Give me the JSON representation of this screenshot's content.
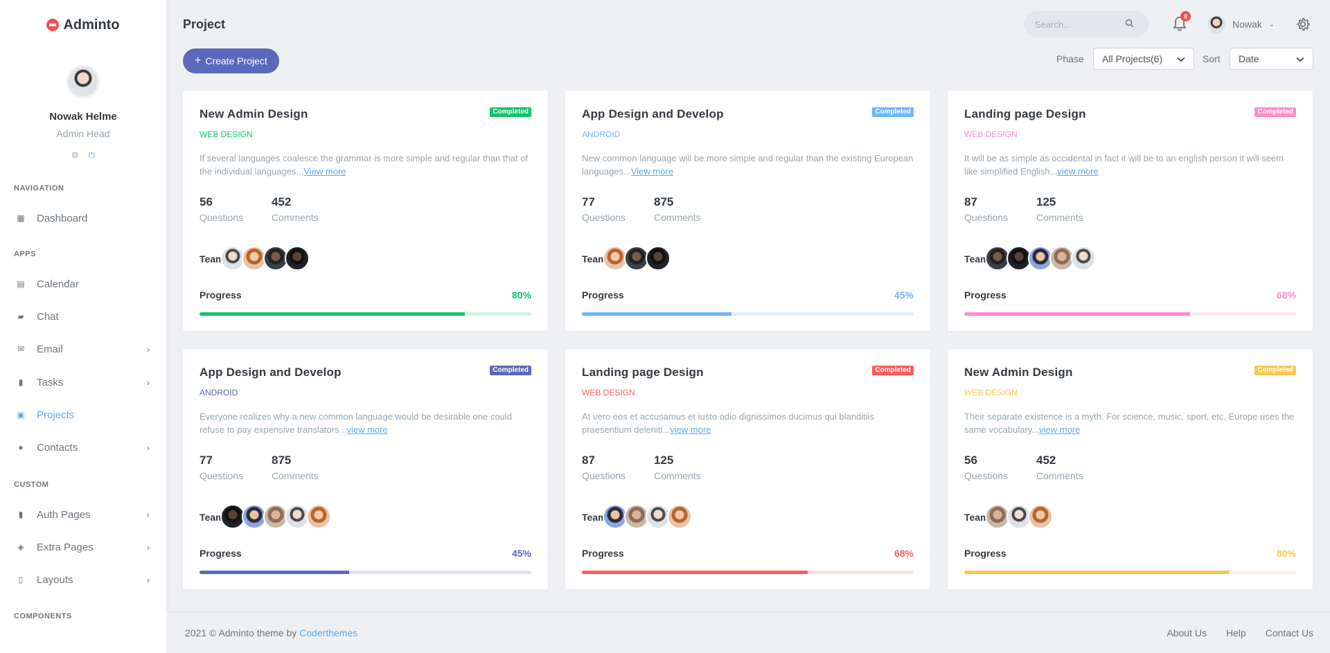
{
  "app": {
    "logo": "Adminto"
  },
  "sidebar": {
    "user_name": "Nowak Helme",
    "user_role": "Admin Head",
    "sections": {
      "navigation": "NAVIGATION",
      "apps": "APPS",
      "custom": "CUSTOM",
      "components": "COMPONENTS"
    },
    "items": [
      {
        "label": "Dashboard",
        "icon": "dashboard-icon",
        "chevron": false,
        "active": false
      },
      {
        "label": "Calendar",
        "icon": "calendar-icon",
        "chevron": false,
        "active": false
      },
      {
        "label": "Chat",
        "icon": "chat-icon",
        "chevron": false,
        "active": false
      },
      {
        "label": "Email",
        "icon": "email-icon",
        "chevron": true,
        "active": false
      },
      {
        "label": "Tasks",
        "icon": "tasks-icon",
        "chevron": true,
        "active": false
      },
      {
        "label": "Projects",
        "icon": "projects-icon",
        "chevron": false,
        "active": true
      },
      {
        "label": "Contacts",
        "icon": "contacts-icon",
        "chevron": true,
        "active": false
      },
      {
        "label": "Auth Pages",
        "icon": "auth-icon",
        "chevron": true,
        "active": false
      },
      {
        "label": "Extra Pages",
        "icon": "layers-icon",
        "chevron": true,
        "active": false
      },
      {
        "label": "Layouts",
        "icon": "layouts-icon",
        "chevron": true,
        "active": false
      }
    ]
  },
  "topbar": {
    "page_title": "Project",
    "search_placeholder": "Search...",
    "notification_count": "9",
    "user_name": "Nowak"
  },
  "toolbar": {
    "create_label": "Create Project",
    "phase_label": "Phase",
    "phase_value": "All Projects(6)",
    "sort_label": "Sort",
    "sort_value": "Date"
  },
  "colors": {
    "success": "#10c469",
    "info": "#71b6f9",
    "pink": "#ff8acc",
    "primary": "#5b69bc",
    "danger": "#ff5b5b",
    "warning": "#f9c851"
  },
  "projects": [
    {
      "title": "New Admin Design",
      "badge": "Completed",
      "category": "WEB DESIGN",
      "color": "#10c469",
      "track": "#d2f3e1",
      "description": "If several languages coalesce the grammar is more simple and regular than that of the individual languages...",
      "more": "View more",
      "questions": "56",
      "comments": "452",
      "questions_label": "Questions",
      "comments_label": "Comments",
      "team_label": "Team :",
      "team_count": 4,
      "progress_label": "Progress",
      "progress": "80%",
      "progress_value": 0.8
    },
    {
      "title": "App Design and Develop",
      "badge": "Completed",
      "category": "ANDROID",
      "color": "#71b6f9",
      "track": "#e3f0fd",
      "description": "New common language will be more simple and regular than the existing European languages...",
      "more": "View more",
      "questions": "77",
      "comments": "875",
      "questions_label": "Questions",
      "comments_label": "Comments",
      "team_label": "Team :",
      "team_count": 3,
      "progress_label": "Progress",
      "progress": "45%",
      "progress_value": 0.45
    },
    {
      "title": "Landing page Design",
      "badge": "Completed",
      "category": "WEB DESIGN",
      "color": "#ff8acc",
      "track": "#ffe8f5",
      "description": "It will be as simple as occidental in fact it will be to an english person it will seem like simplified English...",
      "more": "view more",
      "questions": "87",
      "comments": "125",
      "questions_label": "Questions",
      "comments_label": "Comments",
      "team_label": "Team :",
      "team_count": 5,
      "progress_label": "Progress",
      "progress": "68%",
      "progress_value": 0.68
    },
    {
      "title": "App Design and Develop",
      "badge": "Completed",
      "category": "ANDROID",
      "color": "#5b69bc",
      "track": "#dfe1ea",
      "description": "Everyone realizes why a new common language would be desirable one could refuse to pay expensive translators...",
      "more": "view more",
      "questions": "77",
      "comments": "875",
      "questions_label": "Questions",
      "comments_label": "Comments",
      "team_label": "Team :",
      "team_count": 5,
      "progress_label": "Progress",
      "progress": "45%",
      "progress_value": 0.45
    },
    {
      "title": "Landing page Design",
      "badge": "Completed",
      "category": "WEB DESIGN",
      "color": "#ff5b5b",
      "track": "#fde0e0",
      "description": "At vero eos et accusamus et iusto odio dignissimos ducimus qui blanditiis praesentium deleniti...",
      "more": "view more",
      "questions": "87",
      "comments": "125",
      "questions_label": "Questions",
      "comments_label": "Comments",
      "team_label": "Team :",
      "team_count": 4,
      "progress_label": "Progress",
      "progress": "68%",
      "progress_value": 0.68
    },
    {
      "title": "New Admin Design",
      "badge": "Completed",
      "category": "WEB DESIGN",
      "color": "#f9c851",
      "track": "#fdf3dc",
      "description": "Their separate existence is a myth. For science, music, sport, etc, Europe uses the same vocabulary...",
      "more": "view more",
      "questions": "56",
      "comments": "452",
      "questions_label": "Questions",
      "comments_label": "Comments",
      "team_label": "Team :",
      "team_count": 3,
      "progress_label": "Progress",
      "progress": "80%",
      "progress_value": 0.8
    }
  ],
  "footer": {
    "copyright": "2021 © Adminto theme by",
    "brand_link": "Coderthemes",
    "links": [
      "About Us",
      "Help",
      "Contact Us"
    ]
  }
}
